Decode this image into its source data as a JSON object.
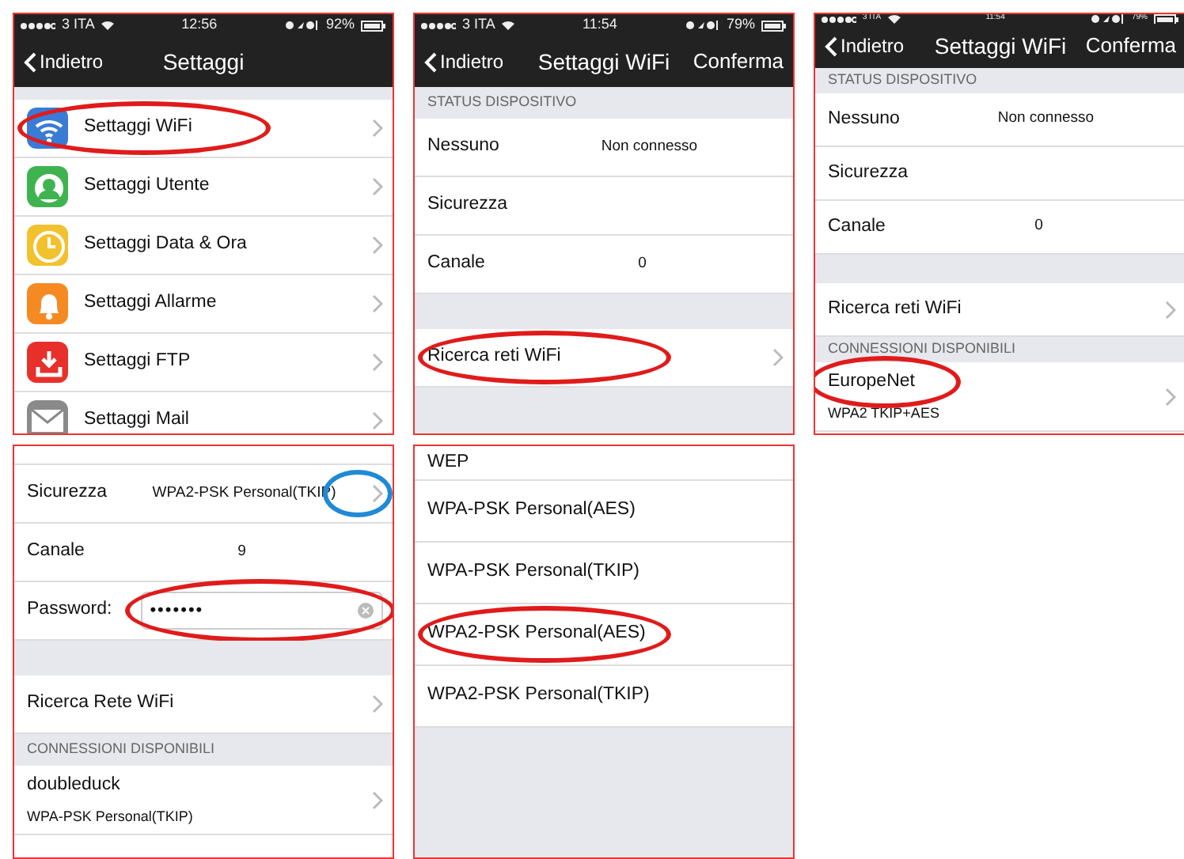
{
  "panels": [
    {
      "status_bar": {
        "carrier": "3 ITA",
        "time": "12:56",
        "battery": "92%"
      },
      "nav_bar": {
        "back": "Indietro",
        "title": "Settaggi"
      },
      "rows": [
        {
          "kind": "gap"
        },
        {
          "kind": "menu",
          "label": "Settaggi WiFi",
          "color": "#3a7bd5",
          "chevron": true,
          "circle": {
            "color": "#e01b1b"
          }
        },
        {
          "kind": "menu",
          "label": "Settaggi Utente",
          "color": "#3fb34f",
          "chevron": true
        },
        {
          "kind": "menu",
          "label": "Settaggi Data & Ora",
          "color": "#f2c12e",
          "chevron": true
        },
        {
          "kind": "menu",
          "label": "Settaggi Allarme",
          "color": "#f58a23",
          "chevron": true
        },
        {
          "kind": "menu",
          "label": "Settaggi FTP",
          "color": "#e8302b",
          "chevron": true
        },
        {
          "kind": "menu",
          "label": "Settaggi Mail",
          "color": "#8a8a8a",
          "chevron": true
        }
      ]
    },
    {
      "status_bar": {
        "carrier": "3 ITA",
        "time": "11:54",
        "battery": "79%"
      },
      "nav_bar": {
        "back": "Indietro",
        "title": "Settaggi WiFi",
        "action": "Conferma"
      },
      "rows": [
        {
          "kind": "header",
          "label": "STATUS DISPOSITIVO"
        },
        {
          "kind": "info",
          "label": "Nessuno",
          "value": "Non connesso"
        },
        {
          "kind": "info",
          "label": "Sicurezza"
        },
        {
          "kind": "info",
          "label": "Canale",
          "value": "0"
        },
        {
          "kind": "gap"
        },
        {
          "kind": "link",
          "label": "Ricerca reti WiFi",
          "chevron": true,
          "circle": {
            "color": "#e01b1b"
          }
        },
        {
          "kind": "gap"
        }
      ]
    },
    {
      "status_bar": {
        "carrier": "3 ITA",
        "time": "11:54",
        "battery": "79%"
      },
      "nav_bar": {
        "back": "Indietro",
        "title": "Settaggi WiFi",
        "action": "Conferma"
      },
      "rows": [
        {
          "kind": "header",
          "label": "STATUS DISPOSITIVO"
        },
        {
          "kind": "info",
          "label": "Nessuno",
          "value": "Non connesso"
        },
        {
          "kind": "info",
          "label": "Sicurezza"
        },
        {
          "kind": "info",
          "label": "Canale",
          "value": "0"
        },
        {
          "kind": "gap"
        },
        {
          "kind": "link",
          "label": "Ricerca reti WiFi",
          "chevron": true
        },
        {
          "kind": "header",
          "label": "CONNESSIONI DISPONIBILI"
        },
        {
          "kind": "network",
          "label": "EuropeNet",
          "sublabel": "WPA2 TKIP+AES",
          "chevron": true,
          "circle": {
            "color": "#e01b1b"
          }
        }
      ]
    },
    {
      "rows": [
        {
          "kind": "blank"
        },
        {
          "kind": "info",
          "label": "Sicurezza",
          "value": "WPA2-PSK Personal(TKIP)",
          "chevron": true,
          "circle": {
            "color": "#1f8ad6"
          }
        },
        {
          "kind": "info",
          "label": "Canale",
          "value": "9"
        },
        {
          "kind": "password",
          "label": "Password:",
          "value": "•••••••",
          "circle": {
            "color": "#e01b1b"
          }
        },
        {
          "kind": "gap"
        },
        {
          "kind": "link",
          "label": "Ricerca Rete WiFi",
          "chevron": true
        },
        {
          "kind": "header",
          "label": "CONNESSIONI DISPONIBILI"
        },
        {
          "kind": "network",
          "label": "doubleduck",
          "sublabel": "WPA-PSK Personal(TKIP)",
          "chevron": true
        }
      ]
    },
    {
      "rows": [
        {
          "kind": "option",
          "label": "WEP"
        },
        {
          "kind": "option",
          "label": "WPA-PSK Personal(AES)"
        },
        {
          "kind": "option",
          "label": "WPA-PSK Personal(TKIP)"
        },
        {
          "kind": "option",
          "label": "WPA2-PSK Personal(AES)",
          "circle": {
            "color": "#e01b1b"
          }
        },
        {
          "kind": "option",
          "label": "WPA2-PSK Personal(TKIP)"
        },
        {
          "kind": "gap"
        }
      ]
    }
  ]
}
